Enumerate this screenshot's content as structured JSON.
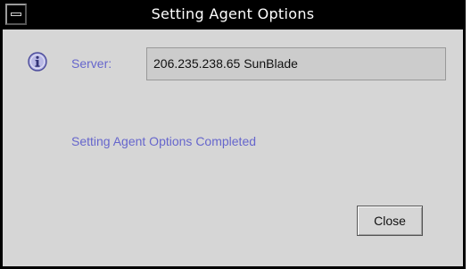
{
  "window": {
    "title": "Setting Agent Options"
  },
  "server": {
    "label": "Server:",
    "value": "206.235.238.65 SunBlade"
  },
  "status": {
    "message": "Setting Agent Options Completed"
  },
  "actions": {
    "close_label": "Close"
  },
  "icons": {
    "info": "info-icon",
    "window_menu": "window-menu-icon"
  },
  "colors": {
    "titlebar": "#000000",
    "window_bg": "#d6d6d6",
    "label_text": "#6666cc",
    "field_bg": "#cccccc",
    "info_icon": "#7777cc"
  }
}
